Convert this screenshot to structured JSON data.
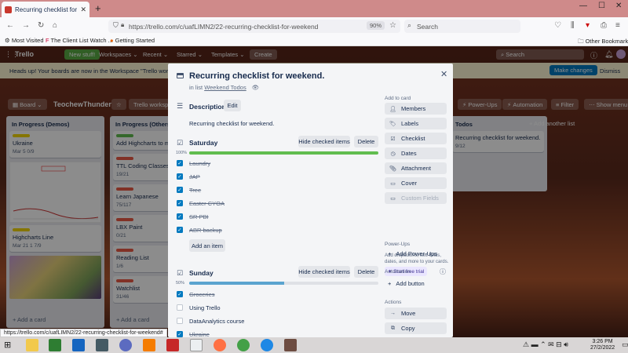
{
  "browser": {
    "tab_title": "Recurring checklist for weeke",
    "url": "https://trello.com/c/uafLIMN2/22-recurring-checklist-for-weekend",
    "zoom": "90%",
    "search_placeholder": "Search",
    "bookmarks": [
      "Most Visited",
      "The Client List Watch ...",
      "Getting Started"
    ],
    "other_bookmarks": "Other Bookmarks",
    "status_url": "https://trello.com/c/uafLIMN2/22-recurring-checklist-for-weekend#"
  },
  "trello_header": {
    "logo": "Trello",
    "new_stuff": "New stuff!",
    "workspaces": "Workspaces",
    "recent": "Recent",
    "starred": "Starred",
    "templates": "Templates",
    "create": "Create",
    "search": "Search"
  },
  "banner": {
    "text": "Heads up! Your boards are now in the Workspace \"Trello workspace\"",
    "make_changes": "Make changes",
    "dismiss": "Dismiss"
  },
  "board_header": {
    "view": "Board",
    "board_name": "TeochewThunder",
    "workspace": "Trello workspace",
    "power_ups": "Power-Ups",
    "automation": "Automation",
    "filter": "Filter",
    "show_menu": "Show menu"
  },
  "lists": {
    "demos": {
      "title": "In Progress (Demos)",
      "card1": "Ukraine",
      "card1_meta": "Mar 5   0/9",
      "card2": "Highcharts Line",
      "card2_meta": "Mar 21   1   7/9",
      "add": "+ Add a card"
    },
    "others": {
      "title": "In Progress (Others)",
      "cards": [
        "Add Highcharts to men",
        "TTL Coding Classes",
        "Learn Japanese",
        "LBX Paint",
        "Reading List",
        "Watchlist"
      ],
      "metas": [
        "",
        "19/21",
        "75/117",
        "0/21",
        "1/6",
        "31/46"
      ],
      "add": "+ Add a card"
    },
    "todos": {
      "title": "Todos",
      "card": "Recurring checklist for weekend.",
      "meta": "9/12",
      "add_list": "+ Add another list"
    }
  },
  "modal": {
    "title": "Recurring checklist for weekend.",
    "in_list_prefix": "in list",
    "in_list_name": "Weekend Todos",
    "description_title": "Description",
    "edit": "Edit",
    "description": "Recurring checklist for weekend.",
    "hide_checked": "Hide checked items",
    "delete": "Delete",
    "add_item": "Add an item",
    "checklists": [
      {
        "title": "Saturday",
        "percent": "100%",
        "progress": 1.0,
        "items": [
          {
            "text": "Laundry",
            "done": true
          },
          {
            "text": "JAP",
            "done": true
          },
          {
            "text": "Tree",
            "done": true
          },
          {
            "text": "Easter CYOA",
            "done": true
          },
          {
            "text": "SR PBI",
            "done": true
          },
          {
            "text": "ABR backup",
            "done": true
          }
        ]
      },
      {
        "title": "Sunday",
        "percent": "50%",
        "progress": 0.5,
        "items": [
          {
            "text": "Groceries",
            "done": true
          },
          {
            "text": "Using Trello",
            "done": false
          },
          {
            "text": "DataAnalytics course",
            "done": false
          },
          {
            "text": "Ukraine",
            "done": true
          }
        ]
      }
    ]
  },
  "sidebar": {
    "add_to_card": "Add to card",
    "members": "Members",
    "labels": "Labels",
    "checklist": "Checklist",
    "dates": "Dates",
    "attachment": "Attachment",
    "cover": "Cover",
    "custom_fields": "Custom Fields",
    "hint": "Add dropdowns, text fields, dates, and more to your cards.",
    "free_trial": "Start free trial",
    "power_ups": "Power-Ups",
    "add_power_ups": "Add Power-Ups",
    "automation": "Automation",
    "add_button": "Add button",
    "actions": "Actions",
    "move": "Move",
    "copy": "Copy"
  },
  "taskbar": {
    "time": "3:26 PM",
    "date": "27/2/2022"
  },
  "colors": {
    "progress_complete": "#61bd4f",
    "progress_partial": "#5ba4cf",
    "checkbox": "#0079bf",
    "trello_blue": "#0079bf"
  }
}
